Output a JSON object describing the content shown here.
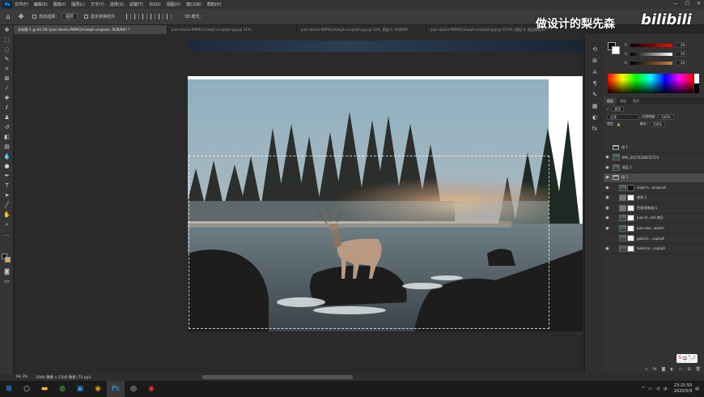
{
  "menu": {
    "app_icon": "Ps",
    "items": [
      "文件(F)",
      "编辑(E)",
      "图像(I)",
      "图层(L)",
      "文字(Y)",
      "选择(S)",
      "滤镜(T)",
      "3D(D)",
      "视图(V)",
      "窗口(W)",
      "帮助(H)"
    ],
    "window_buttons": [
      "—",
      "☐",
      "✕"
    ]
  },
  "options": {
    "auto_select_label": "自动选择：",
    "auto_select_value": "图层",
    "show_transform_label": "显示变换控件",
    "mode_3d_label": "3D 模式："
  },
  "tabs": [
    {
      "label": "未标题-1 @ 64.3% (juan-davila-P8PlK2nGwqA-unsplash, RGB/8#) *",
      "active": true
    },
    {
      "label": "juan-davila-P8PlK2nGwqA-unsplash.jpg @ 21%...",
      "active": false
    },
    {
      "label": "juan-davila-P8PlK2nGwqA-unsplash.jpg @ 33%, 图层 0, RGB/8#",
      "active": false
    },
    {
      "label": "juan-davila-P8PlK2nGwqA-unsplash.jpg @ 55.6% (图层 0, 图层蒙版/8) *",
      "active": false
    }
  ],
  "watermark": {
    "text": "做设计的梨先森",
    "brand": "bilibili"
  },
  "color_panel": {
    "sliders": [
      {
        "label": "R",
        "value": "28"
      },
      {
        "label": "G",
        "value": "28"
      },
      {
        "label": "B",
        "value": "28"
      }
    ]
  },
  "layers_panel": {
    "tabs": [
      "图层",
      "通道",
      "路径"
    ],
    "kind_filter": "类型",
    "blend_mode": "正常",
    "opacity_label": "不透明度:",
    "opacity_value": "100%",
    "lock_label": "锁定:",
    "fill_label": "填充:",
    "fill_value": "100%",
    "layers": [
      {
        "name": "组 1",
        "type": "group",
        "visible": false,
        "indent": 0,
        "selected": false
      },
      {
        "name": "IMG_20170208155723",
        "type": "image",
        "visible": true,
        "indent": 0,
        "selected": false
      },
      {
        "name": "图层 1",
        "type": "image",
        "visible": true,
        "indent": 0,
        "selected": false
      },
      {
        "name": "组 3",
        "type": "group",
        "visible": true,
        "indent": 0,
        "selected": true
      },
      {
        "name": "elijah-h...unsplash",
        "type": "masked",
        "visible": true,
        "indent": 1,
        "selected": false
      },
      {
        "name": "曲线 3",
        "type": "adjust",
        "visible": true,
        "indent": 1,
        "selected": false
      },
      {
        "name": "色相/饱和度 1",
        "type": "adjust",
        "visible": true,
        "indent": 1,
        "selected": false
      },
      {
        "name": "juan-d...ash 拷贝",
        "type": "masked",
        "visible": true,
        "indent": 1,
        "selected": false
      },
      {
        "name": "juan-dav...splash",
        "type": "masked",
        "visible": true,
        "indent": 1,
        "selected": false
      },
      {
        "name": "gabriel-...nsplash",
        "type": "masked",
        "visible": false,
        "indent": 1,
        "selected": false
      },
      {
        "name": "federico...nsplash",
        "type": "masked",
        "visible": true,
        "indent": 1,
        "selected": false
      }
    ],
    "bottom_icons": [
      "link-icon",
      "fx-icon",
      "mask-icon",
      "adjust-icon",
      "folder-icon",
      "new-layer-icon",
      "trash-icon"
    ]
  },
  "statusbar": {
    "zoom": "64.3%",
    "doc_info": "2944 像素 x 2108 像素 (72 ppi)"
  },
  "taskbar": {
    "apps": [
      "start-icon",
      "search-icon",
      "file-explorer-icon",
      "chrome-icon",
      "store-icon",
      "app-icon",
      "photoshop-icon",
      "obs-icon",
      "netease-icon"
    ],
    "time": "23:21:50",
    "date": "2020/5/9"
  }
}
